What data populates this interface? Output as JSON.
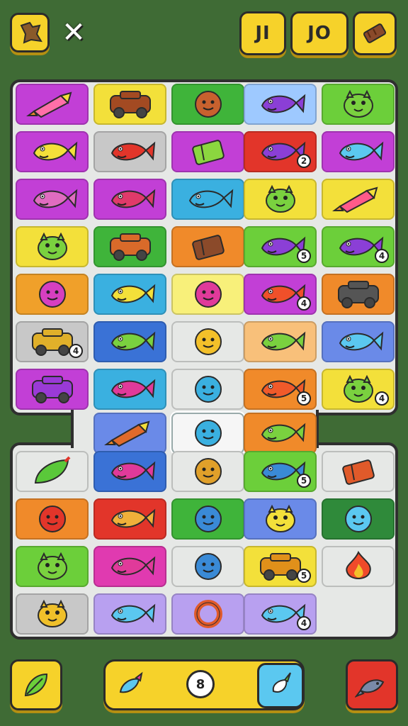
{
  "header": {
    "counter_left": "JI",
    "counter_right": "JO"
  },
  "colors": {
    "background": "#3f6b35",
    "button": "#f6d22a",
    "board": "#e6e8e6"
  },
  "tiles": [
    {
      "row": 0,
      "col": 0,
      "bg": "#c23fd6",
      "icon": "rocket",
      "fg": "#ff6fa8",
      "badge": ""
    },
    {
      "row": 0,
      "col": 1,
      "bg": "#f3e03a",
      "icon": "car",
      "fg": "#a34a22",
      "badge": ""
    },
    {
      "row": 0,
      "col": 2,
      "bg": "#3fb43a",
      "icon": "blob",
      "fg": "#c8612e",
      "badge": ""
    },
    {
      "row": 0,
      "col": 3,
      "bg": "#9ec9ff",
      "icon": "fish",
      "fg": "#8b3fd6",
      "badge": ""
    },
    {
      "row": 0,
      "col": 4,
      "bg": "#6ccf3a",
      "icon": "creature",
      "fg": "#7ad13f",
      "badge": ""
    },
    {
      "row": 1,
      "col": 0,
      "bg": "#c23fd6",
      "icon": "fish",
      "fg": "#f3e03a",
      "badge": ""
    },
    {
      "row": 1,
      "col": 1,
      "bg": "#c8c8c8",
      "icon": "fish",
      "fg": "#e2352a",
      "badge": ""
    },
    {
      "row": 1,
      "col": 2,
      "bg": "#c23fd6",
      "icon": "box",
      "fg": "#8bd63f",
      "badge": ""
    },
    {
      "row": 1,
      "col": 3,
      "bg": "#e2352a",
      "icon": "fish",
      "fg": "#8b3fd6",
      "badge": "2"
    },
    {
      "row": 1,
      "col": 4,
      "bg": "#c23fd6",
      "icon": "fish",
      "fg": "#5bc8f0",
      "badge": ""
    },
    {
      "row": 2,
      "col": 0,
      "bg": "#c23fd6",
      "icon": "fish",
      "fg": "#e06cc0",
      "badge": ""
    },
    {
      "row": 2,
      "col": 1,
      "bg": "#c23fd6",
      "icon": "fish",
      "fg": "#e03a6a",
      "badge": ""
    },
    {
      "row": 2,
      "col": 2,
      "bg": "#3ab0e0",
      "icon": "fish",
      "fg": "#3ab0e0",
      "badge": ""
    },
    {
      "row": 2,
      "col": 3,
      "bg": "#f3e03a",
      "icon": "creature",
      "fg": "#7ad13f",
      "badge": ""
    },
    {
      "row": 2,
      "col": 4,
      "bg": "#f3e03a",
      "icon": "rocket",
      "fg": "#ff5a8a",
      "badge": ""
    },
    {
      "row": 3,
      "col": 0,
      "bg": "#f3e03a",
      "icon": "creature",
      "fg": "#7ad13f",
      "badge": ""
    },
    {
      "row": 3,
      "col": 1,
      "bg": "#3fb43a",
      "icon": "car",
      "fg": "#d96a2a",
      "badge": ""
    },
    {
      "row": 3,
      "col": 2,
      "bg": "#f08a2a",
      "icon": "box",
      "fg": "#8b4a2a",
      "badge": ""
    },
    {
      "row": 3,
      "col": 3,
      "bg": "#6ccf3a",
      "icon": "fish",
      "fg": "#8b3fd6",
      "badge": "5"
    },
    {
      "row": 3,
      "col": 4,
      "bg": "#6ccf3a",
      "icon": "fish",
      "fg": "#8b3fd6",
      "badge": "4"
    },
    {
      "row": 4,
      "col": 0,
      "bg": "#f0a02a",
      "icon": "blob",
      "fg": "#d63fc0",
      "badge": ""
    },
    {
      "row": 4,
      "col": 1,
      "bg": "#3ab0e0",
      "icon": "fish",
      "fg": "#f3e03a",
      "badge": ""
    },
    {
      "row": 4,
      "col": 2,
      "bg": "#f8f07a",
      "icon": "blob",
      "fg": "#e03a9a",
      "badge": ""
    },
    {
      "row": 4,
      "col": 3,
      "bg": "#c23fd6",
      "icon": "fish",
      "fg": "#f0502a",
      "badge": "4"
    },
    {
      "row": 4,
      "col": 4,
      "bg": "#f08a2a",
      "icon": "car",
      "fg": "#555555",
      "badge": ""
    },
    {
      "row": 5,
      "col": 0,
      "bg": "#c8c8c8",
      "icon": "car",
      "fg": "#e0b02a",
      "badge": "4"
    },
    {
      "row": 5,
      "col": 1,
      "bg": "#3a72d6",
      "icon": "fish",
      "fg": "#7ad13f",
      "badge": ""
    },
    {
      "row": 5,
      "col": 2,
      "bg": "#e6e8e6",
      "icon": "blob",
      "fg": "#f3c02a",
      "badge": ""
    },
    {
      "row": 5,
      "col": 3,
      "bg": "#f8c07a",
      "icon": "fish",
      "fg": "#7ad13f",
      "badge": ""
    },
    {
      "row": 5,
      "col": 4,
      "bg": "#6a8ae8",
      "icon": "fish",
      "fg": "#5bc8f0",
      "badge": ""
    },
    {
      "row": 6,
      "col": 0,
      "bg": "#c23fd6",
      "icon": "car",
      "fg": "#9a3ad6",
      "badge": ""
    },
    {
      "row": 6,
      "col": 1,
      "bg": "#3ab0e0",
      "icon": "fish",
      "fg": "#e03a9a",
      "badge": ""
    },
    {
      "row": 6,
      "col": 2,
      "bg": "#e6e8e6",
      "icon": "blob",
      "fg": "#3ab0e0",
      "badge": ""
    },
    {
      "row": 6,
      "col": 3,
      "bg": "#f08a2a",
      "icon": "fish",
      "fg": "#f05a2a",
      "badge": "5"
    },
    {
      "row": 6,
      "col": 4,
      "bg": "#f3e03a",
      "icon": "creature",
      "fg": "#7ad13f",
      "badge": "4"
    },
    {
      "row": 7,
      "col": 0,
      "bg": "",
      "icon": "",
      "fg": "",
      "badge": ""
    },
    {
      "row": 7,
      "col": 1,
      "bg": "#6a8ae8",
      "icon": "rocket",
      "fg": "#e06a2a",
      "badge": ""
    },
    {
      "row": 7,
      "col": 2,
      "bg": "#f6f6f6",
      "icon": "blob",
      "fg": "#3ab0e0",
      "badge": "",
      "selected": true
    },
    {
      "row": 7,
      "col": 3,
      "bg": "#f08a2a",
      "icon": "fish",
      "fg": "#7ad13f",
      "badge": ""
    },
    {
      "row": 7,
      "col": 4,
      "bg": "",
      "icon": "",
      "fg": "",
      "badge": ""
    },
    {
      "row": 8,
      "col": 0,
      "bg": "#e6e8e6",
      "icon": "leaf",
      "fg": "#5ac83a",
      "badge": ""
    },
    {
      "row": 8,
      "col": 1,
      "bg": "#3a72d6",
      "icon": "fish",
      "fg": "#e03a9a",
      "badge": ""
    },
    {
      "row": 8,
      "col": 2,
      "bg": "#e6e8e6",
      "icon": "blob",
      "fg": "#e0a02a",
      "badge": ""
    },
    {
      "row": 8,
      "col": 3,
      "bg": "#6ccf3a",
      "icon": "fish",
      "fg": "#3a8ad6",
      "badge": "5"
    },
    {
      "row": 8,
      "col": 4,
      "bg": "#e6e8e6",
      "icon": "box",
      "fg": "#e05a2a",
      "badge": ""
    },
    {
      "row": 9,
      "col": 0,
      "bg": "#f08a2a",
      "icon": "blob",
      "fg": "#e2352a",
      "badge": ""
    },
    {
      "row": 9,
      "col": 1,
      "bg": "#e2352a",
      "icon": "fish",
      "fg": "#f0b03a",
      "badge": ""
    },
    {
      "row": 9,
      "col": 2,
      "bg": "#3fb43a",
      "icon": "blob",
      "fg": "#3a8ad6",
      "badge": ""
    },
    {
      "row": 9,
      "col": 3,
      "bg": "#6a8ae8",
      "icon": "creature",
      "fg": "#f3e03a",
      "badge": ""
    },
    {
      "row": 9,
      "col": 4,
      "bg": "#2f8a3a",
      "icon": "blob",
      "fg": "#5bc8f0",
      "badge": ""
    },
    {
      "row": 10,
      "col": 0,
      "bg": "#6ccf3a",
      "icon": "creature",
      "fg": "#7ad13f",
      "badge": ""
    },
    {
      "row": 10,
      "col": 1,
      "bg": "#e03ab0",
      "icon": "fish",
      "fg": "#e03a9a",
      "badge": ""
    },
    {
      "row": 10,
      "col": 2,
      "bg": "#e6e8e6",
      "icon": "blob",
      "fg": "#3a8ad6",
      "badge": ""
    },
    {
      "row": 10,
      "col": 3,
      "bg": "#f3e03a",
      "icon": "car",
      "fg": "#e0901a",
      "badge": "5"
    },
    {
      "row": 10,
      "col": 4,
      "bg": "#e6e8e6",
      "icon": "flame",
      "fg": "#f04a2a",
      "badge": ""
    },
    {
      "row": 11,
      "col": 0,
      "bg": "#c8c8c8",
      "icon": "creature",
      "fg": "#f0c02a",
      "badge": ""
    },
    {
      "row": 11,
      "col": 1,
      "bg": "#b8a0f0",
      "icon": "fish",
      "fg": "#5bc8f0",
      "badge": ""
    },
    {
      "row": 11,
      "col": 2,
      "bg": "#b8a0f0",
      "icon": "ring",
      "fg": "#e05a2a",
      "badge": ""
    },
    {
      "row": 11,
      "col": 3,
      "bg": "#b8a0f0",
      "icon": "fish",
      "fg": "#5bc8f0",
      "badge": "4"
    },
    {
      "row": 11,
      "col": 4,
      "bg": "",
      "icon": "",
      "fg": "",
      "badge": ""
    }
  ],
  "bottom": {
    "center_bubble": "8"
  }
}
